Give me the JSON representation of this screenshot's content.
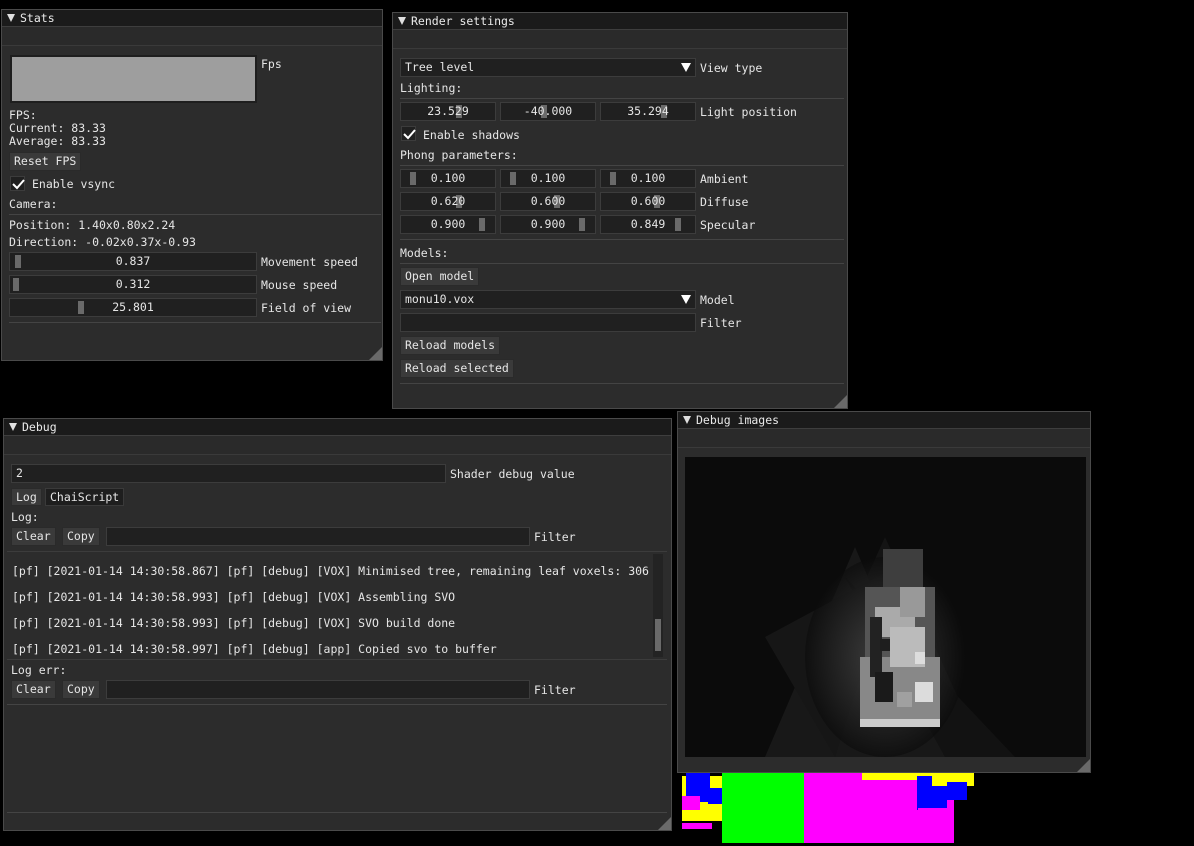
{
  "stats": {
    "title": "Stats",
    "fps_plot_label": "Fps",
    "fps_header": "FPS:",
    "current": "Current: 83.33",
    "average": "Average: 83.33",
    "reset_fps": "Reset FPS",
    "enable_vsync": "Enable vsync",
    "vsync_checked": true,
    "camera_header": "Camera:",
    "position": "Position: 1.40x0.80x2.24",
    "direction": "Direction: -0.02x0.37x-0.93",
    "sliders": [
      {
        "value": "0.837",
        "label": "Movement speed",
        "fraction": 0.02
      },
      {
        "value": "0.312",
        "label": "Mouse speed",
        "fraction": 0.0
      },
      {
        "value": "25.801",
        "label": "Field of view",
        "fraction": 0.28
      }
    ]
  },
  "render": {
    "title": "Render settings",
    "view_type_value": "Tree level",
    "view_type_label": "View type",
    "lighting_header": "Lighting:",
    "light_position": [
      "23.529",
      "-40.000",
      "35.294"
    ],
    "light_position_label": "Light position",
    "enable_shadows": "Enable shadows",
    "shadows_checked": true,
    "phong_header": "Phong parameters:",
    "phong": [
      {
        "label": "Ambient",
        "values": [
          "0.100",
          "0.100",
          "0.100"
        ]
      },
      {
        "label": "Diffuse",
        "values": [
          "0.620",
          "0.600",
          "0.600"
        ]
      },
      {
        "label": "Specular",
        "values": [
          "0.900",
          "0.900",
          "0.849"
        ]
      }
    ],
    "models_header": "Models:",
    "open_model": "Open model",
    "model_value": "monu10.vox",
    "model_label": "Model",
    "filter_value": "",
    "filter_label": "Filter",
    "reload_models": "Reload models",
    "reload_selected": "Reload selected"
  },
  "debug": {
    "title": "Debug",
    "shader_debug_value": "2",
    "shader_debug_label": "Shader debug value",
    "tabs": [
      "Log",
      "ChaiScript"
    ],
    "log_header": "Log:",
    "clear": "Clear",
    "copy": "Copy",
    "filter_label": "Filter",
    "log_lines": [
      "[pf] [2021-01-14 14:30:58.867] [pf] [debug] [VOX] Minimised tree, remaining leaf voxels: 306",
      "[pf] [2021-01-14 14:30:58.993] [pf] [debug] [VOX] Assembling SVO",
      "[pf] [2021-01-14 14:30:58.993] [pf] [debug] [VOX] SVO build done",
      "[pf] [2021-01-14 14:30:58.997] [pf] [debug] [app] Copied svo to buffer"
    ],
    "log_err_header": "Log err:",
    "err_clear": "Clear",
    "err_copy": "Copy",
    "err_filter_label": "Filter"
  },
  "debug_images": {
    "title": "Debug images"
  }
}
